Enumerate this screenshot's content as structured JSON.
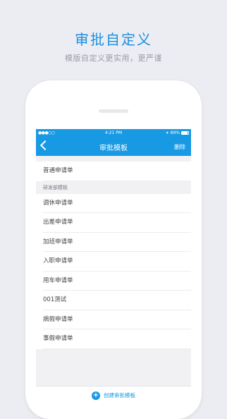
{
  "promo": {
    "title": "审批自定义",
    "subtitle": "模版自定义更实用，更严谨"
  },
  "status_bar": {
    "signal": "●●●○○",
    "time": "4:21 PM",
    "bluetooth": "∗",
    "battery_text": "89%",
    "battery_level": 0.89
  },
  "nav": {
    "title": "审批模板",
    "delete_label": "删除"
  },
  "list": {
    "top_items": [
      {
        "label": "普通申请单"
      }
    ],
    "section_header": "研发部模板",
    "items": [
      {
        "label": "调休申请单"
      },
      {
        "label": "出差申请单"
      },
      {
        "label": "加班申请单"
      },
      {
        "label": "入职申请单"
      },
      {
        "label": "用车申请单"
      },
      {
        "label": "001测试"
      },
      {
        "label": "病假申请单"
      },
      {
        "label": "事假申请单"
      }
    ]
  },
  "bottom": {
    "create_label": "创建审批模板",
    "icon": "plus-circle-icon"
  },
  "colors": {
    "accent": "#1799e3",
    "headline": "#1b8fe0",
    "background": "#ecedf3"
  }
}
